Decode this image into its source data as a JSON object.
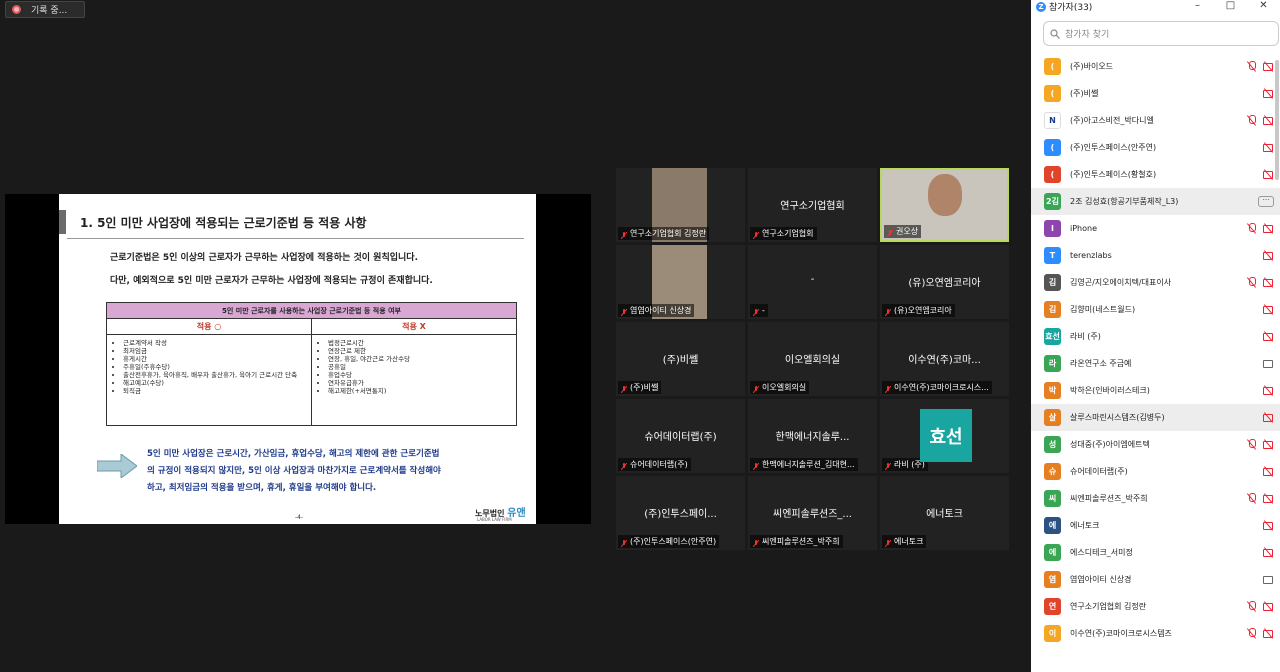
{
  "recording": {
    "label": "기록 중..."
  },
  "slide": {
    "title": "1. 5인 미만 사업장에 적용되는 근로기준법 등 적용 사항",
    "para1": "근로기준법은 5인 이상의 근로자가 근무하는 사업장에 적용하는 것이 원칙입니다.",
    "para2": "다만, 예외적으로 5인 미만 근로자가 근무하는 사업장에 적용되는 규정이 존재합니다.",
    "table_header": "5인 미만 근로자를 사용하는 사업장 근로기준법 등 적용 여부",
    "col_yes": "적용 ○",
    "col_no": "적용 X",
    "yes_items": [
      "근로계약서 작성",
      "최저임금",
      "휴게시간",
      "주휴일(주휴수당)",
      "출산전후휴가, 육아휴직, 배우자 출산휴가, 육아기 근로시간 단축",
      "해고예고(수당)",
      "퇴직금"
    ],
    "no_items": [
      "법정근로시간",
      "연장근로 제한",
      "연장, 휴일, 야간근로 가산수당",
      "공휴일",
      "휴업수당",
      "연차유급휴가",
      "해고제한(+서면통지)"
    ],
    "note1": "5인 미만 사업장은 근로시간, 가산임금, 휴업수당, 해고의 제한에 관한 근로기준법",
    "note2": "의 규정이 적용되지 않지만, 5인 이상 사업장과 마찬가지로 근로계약서를 작성해야",
    "note3": "하고, 최저임금의 적용을 받으며, 휴게, 휴일을 부여해야 합니다.",
    "page_no": "-4-",
    "logo_text": "노무법인",
    "logo_brand": "유앤",
    "logo_sub": "LABOR LAW FIRM"
  },
  "tiles": [
    {
      "center": "",
      "label": "연구소기업협회 김정란"
    },
    {
      "center": "연구소기업협회",
      "label": "연구소기업협회"
    },
    {
      "center": "",
      "label": "권오상"
    },
    {
      "center": "",
      "label": "염염아이티 신상경"
    },
    {
      "center": "-",
      "label": "-"
    },
    {
      "center": "(유)오연엠코리아",
      "label": "(유)오연엠코리아"
    },
    {
      "center": "(주)비쎌",
      "label": "(주)비쎌"
    },
    {
      "center": "이오엘회의실",
      "label": "이오엘회의실"
    },
    {
      "center": "이수연(주)코마...",
      "label": "이수연(주)코마이크로시스..."
    },
    {
      "center": "슈어데이터랩(주)",
      "label": "슈어데이터랩(주)"
    },
    {
      "center": "한맥에너지솔루...",
      "label": "한맥에너지솔루션_김대현..."
    },
    {
      "center": "",
      "label": "라비 (주)"
    },
    {
      "center": "(주)인투스페이...",
      "label": "(주)인투스페이스(안주연)"
    },
    {
      "center": "씨엔피솔루션즈_...",
      "label": "씨엔피솔루션즈_박주희"
    },
    {
      "center": "에너토크",
      "label": "에너토크"
    }
  ],
  "big_badge": "효선",
  "panel": {
    "title": "참가자(33)",
    "search_placeholder": "참가자 찾기",
    "participants": [
      {
        "avatar": "(",
        "color": "#f5a623",
        "name": "(주)바이오드",
        "mic": "off",
        "cam": "off"
      },
      {
        "avatar": "(",
        "color": "#f5a623",
        "name": "(주)비쎌",
        "mic": "",
        "cam": "off"
      },
      {
        "avatar": "N",
        "color": "#ffffff",
        "name": "(주)아고스비전_박다니엘",
        "mic": "off",
        "cam": "off"
      },
      {
        "avatar": "(",
        "color": "#2d8cff",
        "name": "(주)인투스페이스(안주연)",
        "mic": "",
        "cam": "off"
      },
      {
        "avatar": "(",
        "color": "#e0452b",
        "name": "(주)인투스페이스(황철호)",
        "mic": "",
        "cam": "off"
      },
      {
        "avatar": "2김",
        "color": "#3aa655",
        "name": "2조 김성효(항공기부품제작_L3)",
        "mic": "",
        "cam": "more",
        "hl": true
      },
      {
        "avatar": "I",
        "color": "#8e44ad",
        "name": "iPhone",
        "mic": "off",
        "cam": "off"
      },
      {
        "avatar": "T",
        "color": "#2d8cff",
        "name": "terenzlabs",
        "mic": "",
        "cam": "off"
      },
      {
        "avatar": "김",
        "color": "#555555",
        "name": "김영곤/지오에이치텍/대표이사",
        "mic": "off",
        "cam": "off"
      },
      {
        "avatar": "김",
        "color": "#e67e22",
        "name": "김향미(네스트월드)",
        "mic": "",
        "cam": "off"
      },
      {
        "avatar": "효선",
        "color": "#1aa6a0",
        "name": "라비 (주)",
        "mic": "",
        "cam": "off"
      },
      {
        "avatar": "라",
        "color": "#3aa655",
        "name": "라온연구소 주금예",
        "mic": "",
        "cam": "on"
      },
      {
        "avatar": "박",
        "color": "#e67e22",
        "name": "박하은(인바이러스테크)",
        "mic": "",
        "cam": "off"
      },
      {
        "avatar": "살",
        "color": "#e67e22",
        "name": "살루스마린시스템즈(김병두)",
        "mic": "",
        "cam": "off",
        "hl": true
      },
      {
        "avatar": "성",
        "color": "#3aa655",
        "name": "성대중(주)아이엠에트텍",
        "mic": "off",
        "cam": "off"
      },
      {
        "avatar": "슈",
        "color": "#e67e22",
        "name": "슈어데이터랩(주)",
        "mic": "",
        "cam": "off"
      },
      {
        "avatar": "씨",
        "color": "#3aa655",
        "name": "씨엔피솔루션즈_박주희",
        "mic": "off",
        "cam": "off"
      },
      {
        "avatar": "에",
        "color": "#2c5282",
        "name": "에너토크",
        "mic": "",
        "cam": "off"
      },
      {
        "avatar": "에",
        "color": "#3aa655",
        "name": "에스디테크_서미정",
        "mic": "",
        "cam": "off"
      },
      {
        "avatar": "염",
        "color": "#e67e22",
        "name": "염염아이티 신상경",
        "mic": "",
        "cam": "on"
      },
      {
        "avatar": "연",
        "color": "#e0452b",
        "name": "연구소기업협회 김정란",
        "mic": "off",
        "cam": "off"
      },
      {
        "avatar": "이",
        "color": "#f5a623",
        "name": "이수연(주)코마이크로시스템즈",
        "mic": "off",
        "cam": "off"
      }
    ]
  }
}
